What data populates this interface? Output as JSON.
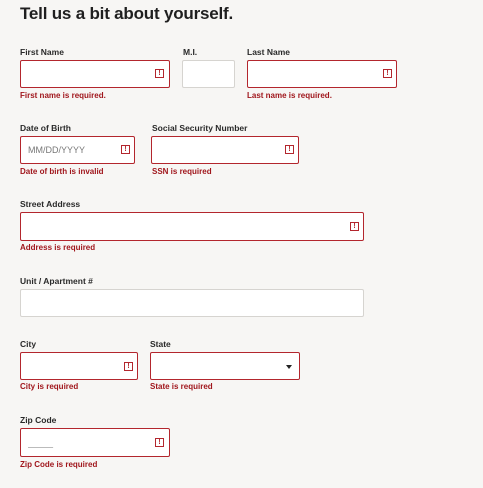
{
  "heading": "Tell us a bit about yourself.",
  "fields": {
    "first_name": {
      "label": "First Name",
      "value": "",
      "error": "First name is required."
    },
    "middle_initial": {
      "label": "M.I.",
      "value": ""
    },
    "last_name": {
      "label": "Last Name",
      "value": "",
      "error": "Last name is required."
    },
    "dob": {
      "label": "Date of Birth",
      "placeholder": "MM/DD/YYYY",
      "error": "Date of birth is invalid"
    },
    "ssn": {
      "label": "Social Security Number",
      "value": "",
      "error": "SSN is required"
    },
    "street": {
      "label": "Street Address",
      "value": "",
      "error": "Address is required"
    },
    "unit": {
      "label": "Unit / Apartment #",
      "value": ""
    },
    "city": {
      "label": "City",
      "value": "",
      "error": "City is required"
    },
    "state": {
      "label": "State",
      "selected": "",
      "error": "State is required"
    },
    "zip": {
      "label": "Zip Code",
      "placeholder": "_____",
      "error": "Zip Code is required"
    }
  },
  "icons": {
    "alert": "!",
    "dropdown": "caret-down"
  },
  "colors": {
    "error": "#a0161c",
    "error_border": "#b3262d",
    "background": "#f7f6f4"
  }
}
